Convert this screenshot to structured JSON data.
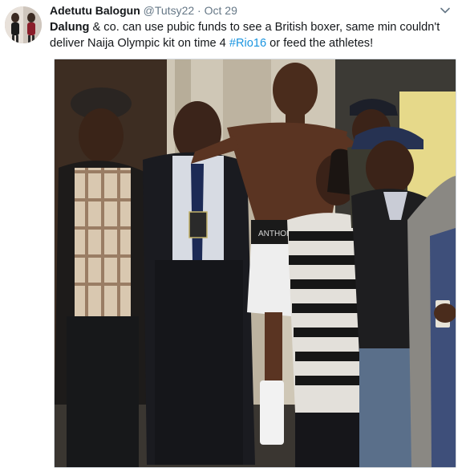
{
  "tweet": {
    "author_name": "Adetutu Balogun",
    "author_handle": "@Tutsy22",
    "separator": "·",
    "date": "Oct 29",
    "text_mention": "Dalung",
    "text_part1": " & co. can use pubic funds to see a British boxer, same min couldn't deliver Naija Olympic kit on time 4 ",
    "hashtag": "#Rio16",
    "text_part2": " or feed the athletes!",
    "shorts_lettering": "ANTHONY JOSHUA"
  },
  "colors": {
    "link": "#1b95e0",
    "secondary_text": "#657786",
    "primary_text": "#14171a",
    "border": "#d5dadf"
  },
  "icons": {
    "menu": "chevron-down-icon"
  }
}
